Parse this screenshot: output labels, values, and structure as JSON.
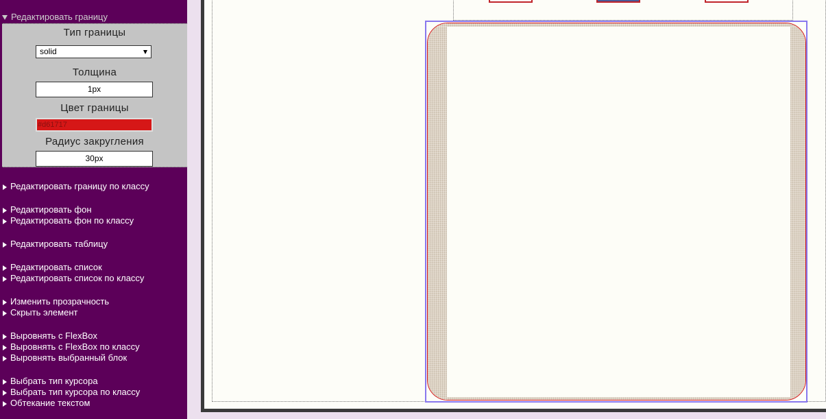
{
  "sidebar": {
    "section_header": "Редактировать границу",
    "border_panel": {
      "border_type_label": "Тип границы",
      "border_type_value": "solid",
      "thickness_label": "Толщина",
      "thickness_value": "1px",
      "border_color_label": "Цвет границы",
      "border_color_value": "#d61717",
      "radius_label": "Радиус закругления",
      "radius_value": "30px"
    },
    "menu_items": [
      "Редактировать границу по классу",
      "Редактировать фон",
      "Редактировать фон по классу",
      "Редактировать таблицу",
      "Редактировать список",
      "Редактировать список по классу",
      "Изменить прозрачность",
      "Скрыть элемент",
      "Выровнять с FlexBox",
      "Выровнять с FlexBox по классу",
      "Выровнять выбранный блок",
      "Выбрать тип курсора",
      "Выбрать тип курсора по классу",
      "Обтекание текстом"
    ]
  },
  "colors": {
    "sidebar_bg": "#5c0059",
    "panel_bg": "#c4c4c4",
    "border_color": "#d61717",
    "selection_outline": "#8877ee"
  },
  "icons": {
    "expanded": "triangle-down-icon",
    "collapsed": "triangle-right-icon",
    "dropdown": "chevron-down-icon"
  }
}
